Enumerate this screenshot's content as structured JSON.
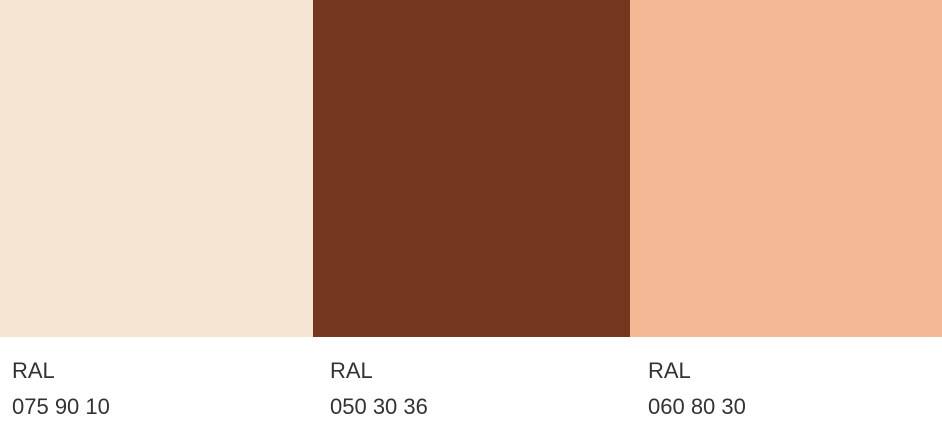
{
  "swatches": [
    {
      "system": "RAL",
      "code": "075 90 10",
      "color": "#F6E4D2"
    },
    {
      "system": "RAL",
      "code": "050 30 36",
      "color": "#753720"
    },
    {
      "system": "RAL",
      "code": "060 80 30",
      "color": "#F3B994"
    }
  ]
}
